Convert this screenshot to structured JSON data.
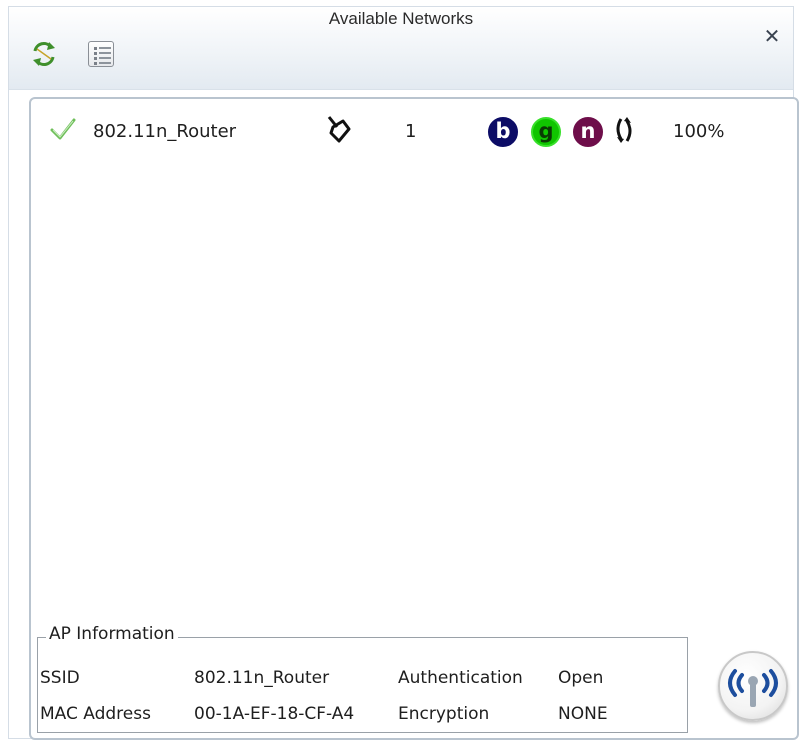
{
  "window": {
    "title": "Available Networks"
  },
  "toolbar": {
    "refresh_icon": "refresh-icon",
    "list_icon": "list-view-icon",
    "close_icon": "close-icon"
  },
  "networks": [
    {
      "ssid": "802.11n_Router",
      "connected_icon": "checkmark-icon",
      "mode_icon": "infrastructure-icon",
      "channel": "1",
      "standards": [
        "b",
        "g",
        "n"
      ],
      "sync_icon": "wps-sync-icon",
      "signal": "100%"
    }
  ],
  "ap_info": {
    "legend": "AP Information",
    "ssid_label": "SSID",
    "ssid_value": "802.11n_Router",
    "mac_label": "MAC Address",
    "mac_value": "00-1A-EF-18-CF-A4",
    "auth_label": "Authentication",
    "auth_value": "Open",
    "enc_label": "Encryption",
    "enc_value": "NONE"
  },
  "connect_button": {
    "icon": "wireless-antenna-icon"
  },
  "colors": {
    "badge_b": "#0c0c66",
    "badge_g": "#10c500",
    "badge_n": "#6e0e4a",
    "check": "#6fbf5a",
    "antenna_waves": "#1d4e9e"
  }
}
